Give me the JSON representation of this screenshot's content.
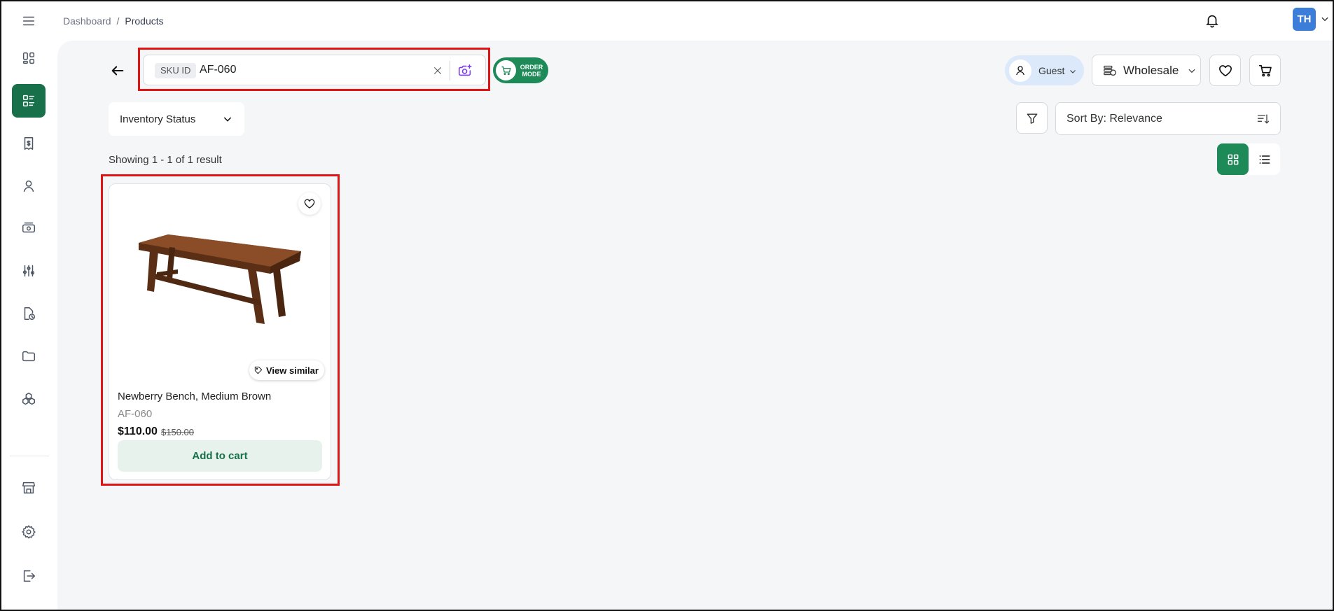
{
  "breadcrumb": {
    "root": "Dashboard",
    "separator": "/",
    "current": "Products"
  },
  "header": {
    "avatar_initials": "TH"
  },
  "search": {
    "chip_label": "SKU ID",
    "value": "AF-060"
  },
  "order_mode": {
    "line1": "ORDER",
    "line2": "MODE"
  },
  "customer": {
    "label": "Guest"
  },
  "pricing": {
    "label": "Wholesale"
  },
  "filters": {
    "inventory_status_label": "Inventory Status",
    "sort_label": "Sort By: Relevance"
  },
  "results": {
    "summary": "Showing 1 - 1 of 1 result",
    "view_mode": "grid"
  },
  "products": [
    {
      "name": "Newberry Bench, Medium Brown",
      "sku": "AF-060",
      "price": "$110.00",
      "original_price": "$150.00",
      "view_similar_label": "View similar",
      "add_to_cart_label": "Add to cart"
    }
  ],
  "sidebar": {
    "items": [
      {
        "icon": "menu-icon"
      },
      {
        "icon": "dashboard-icon"
      },
      {
        "icon": "products-list-icon",
        "active": true
      },
      {
        "icon": "invoice-icon"
      },
      {
        "icon": "user-icon"
      },
      {
        "icon": "payments-icon"
      },
      {
        "icon": "sliders-icon"
      },
      {
        "icon": "reports-icon"
      },
      {
        "icon": "folder-icon"
      },
      {
        "icon": "inventory-icon"
      },
      {
        "icon": "store-icon"
      },
      {
        "icon": "settings-icon"
      },
      {
        "icon": "logout-icon"
      }
    ]
  },
  "colors": {
    "primary_green": "#17704a",
    "order_mode_green": "#1d8a58",
    "highlight_red": "#e01414",
    "avatar_blue": "#3b7dd8"
  }
}
